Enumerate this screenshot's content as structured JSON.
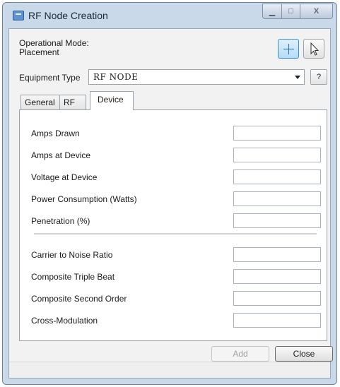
{
  "window": {
    "title": "RF Node Creation",
    "controls": {
      "minimize": "▁",
      "maximize": "□",
      "close": "X"
    }
  },
  "header": {
    "operational_mode_label": "Operational Mode:",
    "operational_mode_value": "Placement",
    "tools": {
      "placement": "crosshair-icon",
      "select": "pointer-icon"
    }
  },
  "equipment": {
    "label": "Equipment Type",
    "selected": "RF NODE",
    "help_label": "?"
  },
  "tabs": [
    {
      "label": "General"
    },
    {
      "label": "RF"
    },
    {
      "label": "Device",
      "active": true
    }
  ],
  "device": {
    "fields": [
      {
        "label": "Amps Drawn",
        "value": ""
      },
      {
        "label": "Amps at Device",
        "value": ""
      },
      {
        "label": "Voltage at Device",
        "value": ""
      },
      {
        "label": "Power Consumption (Watts)",
        "value": ""
      },
      {
        "label": "Penetration (%)",
        "value": ""
      },
      {
        "label": "Carrier to Noise Ratio",
        "value": ""
      },
      {
        "label": "Composite Triple Beat",
        "value": ""
      },
      {
        "label": "Composite Second Order",
        "value": ""
      },
      {
        "label": "Cross-Modulation",
        "value": ""
      }
    ]
  },
  "buttons": {
    "add": "Add",
    "close": "Close"
  }
}
